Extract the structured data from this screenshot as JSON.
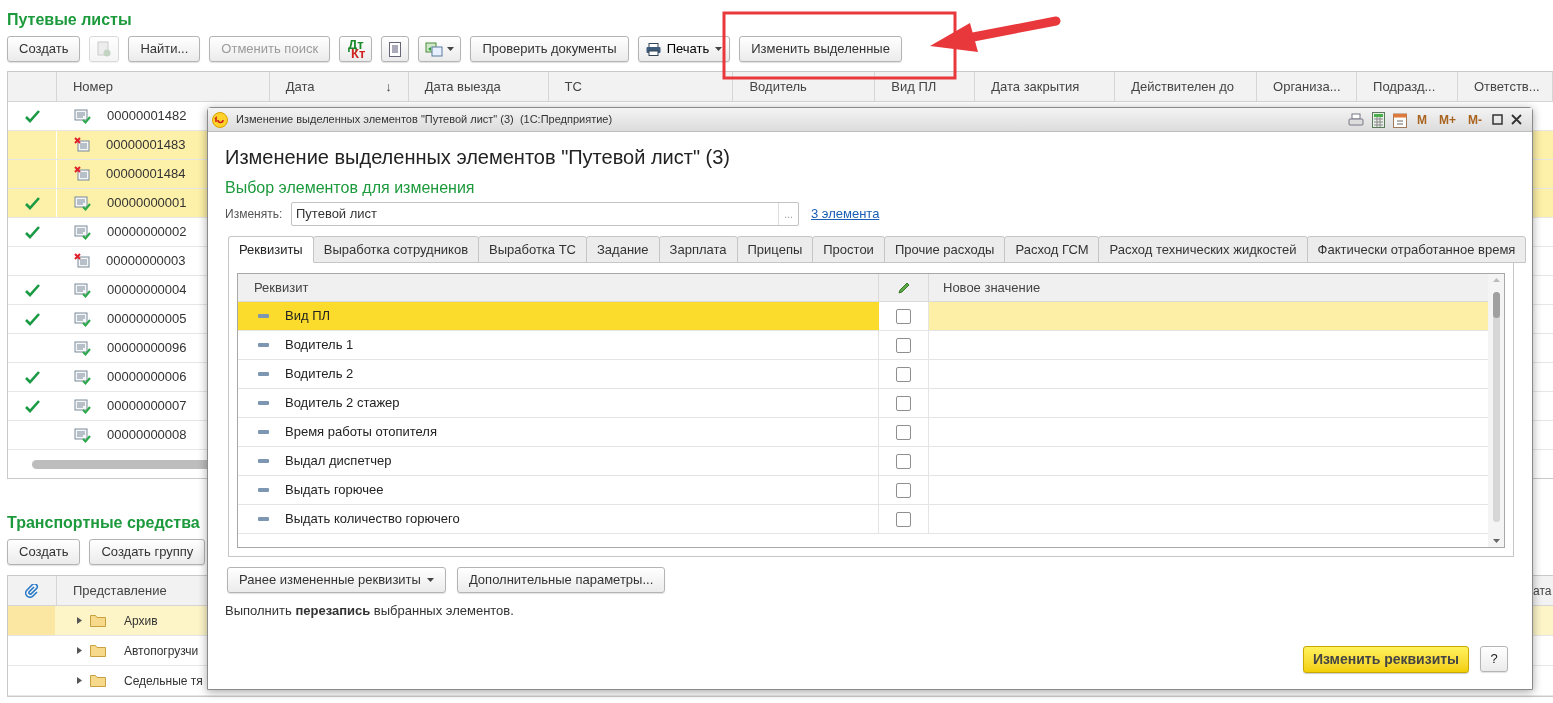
{
  "waybills": {
    "title": "Путевые листы",
    "toolbar": [
      {
        "kind": "text",
        "label": "Создать",
        "disabled": false
      },
      {
        "kind": "copy",
        "disabled": true
      },
      {
        "kind": "text",
        "label": "Найти...",
        "disabled": false
      },
      {
        "kind": "text",
        "label": "Отменить поиск",
        "disabled": true
      },
      {
        "kind": "dtkt",
        "top": "Дт",
        "bottom": "Кт"
      },
      {
        "kind": "report"
      },
      {
        "kind": "generate",
        "dropdown": true
      },
      {
        "kind": "text",
        "label": "Проверить документы",
        "disabled": false
      },
      {
        "kind": "print",
        "label": "Печать",
        "dropdown": true
      },
      {
        "kind": "text",
        "label": "Изменить выделенные",
        "disabled": false
      }
    ],
    "columns": [
      {
        "label": "Номер"
      },
      {
        "label": "Дата",
        "sort": "↓"
      },
      {
        "label": "Дата выезда"
      },
      {
        "label": "ТС"
      },
      {
        "label": "Водитель"
      },
      {
        "label": "Вид ПЛ"
      },
      {
        "label": "Дата закрытия"
      },
      {
        "label": "Действителен до"
      },
      {
        "label": "Организа..."
      },
      {
        "label": "Подразд..."
      },
      {
        "label": "Ответств..."
      }
    ],
    "rows": [
      {
        "number": "00000001482",
        "checked": true,
        "deletion_mark": false,
        "selected": false
      },
      {
        "number": "00000001483",
        "checked": false,
        "deletion_mark": true,
        "selected": true
      },
      {
        "number": "00000001484",
        "checked": false,
        "deletion_mark": true,
        "selected": true
      },
      {
        "number": "00000000001",
        "checked": true,
        "deletion_mark": false,
        "selected": true
      },
      {
        "number": "00000000002",
        "checked": true,
        "deletion_mark": false,
        "selected": false
      },
      {
        "number": "00000000003",
        "checked": false,
        "deletion_mark": true,
        "selected": false
      },
      {
        "number": "00000000004",
        "checked": true,
        "deletion_mark": false,
        "selected": false
      },
      {
        "number": "00000000005",
        "checked": true,
        "deletion_mark": false,
        "selected": false
      },
      {
        "number": "00000000096",
        "checked": false,
        "deletion_mark": false,
        "selected": false
      },
      {
        "number": "00000000006",
        "checked": true,
        "deletion_mark": false,
        "selected": false
      },
      {
        "number": "00000000007",
        "checked": true,
        "deletion_mark": false,
        "selected": false
      },
      {
        "number": "00000000008",
        "checked": false,
        "deletion_mark": false,
        "selected": false
      }
    ]
  },
  "vehicles": {
    "title": "Транспортные средства",
    "toolbar": [
      "Создать",
      "Создать группу"
    ],
    "columns": [
      {
        "label": "Представление"
      }
    ],
    "column_3": "ата",
    "rows": [
      {
        "label": "Архив",
        "selected": true
      },
      {
        "label": "Автопогрузчи",
        "selected": false
      },
      {
        "label": "Седельные тя",
        "selected": false
      }
    ]
  },
  "dialog": {
    "window_title": "Изменение выделенных элементов \"Путевой лист\" (3)  (1С:Предприятие)",
    "title_buttons": [
      "M",
      "M+",
      "M-"
    ],
    "heading": "Изменение выделенных элементов \"Путевой лист\" (3)",
    "subheading": "Выбор элементов для изменения",
    "change_label": "Изменять:",
    "change_value": "Путевой лист",
    "choose_button": "...",
    "count_link": "3 элемента",
    "tabs": [
      {
        "label": "Реквизиты",
        "selected": true
      },
      {
        "label": "Выработка сотрудников",
        "selected": false
      },
      {
        "label": "Выработка ТС",
        "selected": false
      },
      {
        "label": "Задание",
        "selected": false
      },
      {
        "label": "Зарплата",
        "selected": false
      },
      {
        "label": "Прицепы",
        "selected": false
      },
      {
        "label": "Простои",
        "selected": false
      },
      {
        "label": "Прочие расходы",
        "selected": false
      },
      {
        "label": "Расход ГСМ",
        "selected": false
      },
      {
        "label": "Расход технических жидкостей",
        "selected": false
      },
      {
        "label": "Фактически отработанное время",
        "selected": false
      }
    ],
    "table": {
      "columns": [
        "Реквизит",
        "Новое значение"
      ],
      "rows": [
        {
          "name": "Вид ПЛ",
          "checked": false,
          "selected": true
        },
        {
          "name": "Водитель 1",
          "checked": false,
          "selected": false
        },
        {
          "name": "Водитель 2",
          "checked": false,
          "selected": false
        },
        {
          "name": "Водитель 2 стажер",
          "checked": false,
          "selected": false
        },
        {
          "name": "Время работы отопителя",
          "checked": false,
          "selected": false
        },
        {
          "name": "Выдал диспетчер",
          "checked": false,
          "selected": false
        },
        {
          "name": "Выдать горючее",
          "checked": false,
          "selected": false
        },
        {
          "name": "Выдать количество горючего",
          "checked": false,
          "selected": false
        }
      ]
    },
    "buttons": [
      {
        "label": "Ранее измененные реквизиты",
        "dropdown": true
      },
      {
        "label": "Дополнительные параметры...",
        "dropdown": false
      }
    ],
    "note": "Выполнить **перезапись** выбранных элементов.",
    "primary_button": "Изменить реквизиты",
    "help_button": "?"
  }
}
